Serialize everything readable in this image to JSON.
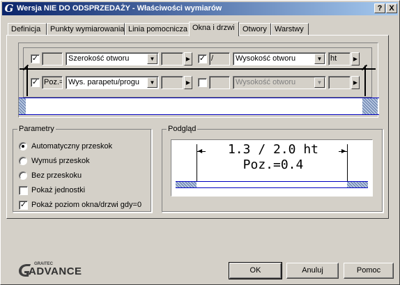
{
  "titlebar": {
    "app_icon": "G",
    "title": "Wersja NIE DO ODSPRZEDAŻY - Właściwości wymiarów",
    "help_button": "?",
    "close_button": "X"
  },
  "tabs": [
    {
      "label": "Definicja",
      "active": false
    },
    {
      "label": "Punkty wymiarowania",
      "active": false
    },
    {
      "label": "Linia pomocnicza",
      "active": false
    },
    {
      "label": "Okna i drzwi",
      "active": true
    },
    {
      "label": "Otwory",
      "active": false
    },
    {
      "label": "Warstwy",
      "active": false
    }
  ],
  "dim_editor": {
    "row1": {
      "left_checked": true,
      "left_prefix": "",
      "left_combo": "Szerokość otworu",
      "left_suffix": "",
      "right_checked": true,
      "right_prefix": "/",
      "right_combo": "Wysokość otworu",
      "right_suffix": "ht",
      "arrow": "▶"
    },
    "row2": {
      "left_checked": true,
      "left_prefix": "Poz.=",
      "left_combo": "Wys. parapetu/progu",
      "left_suffix": "",
      "right_checked": false,
      "right_prefix": "",
      "right_combo": "Wysokość otworu",
      "right_suffix": "",
      "arrow": "▶"
    }
  },
  "parametry": {
    "label": "Parametry",
    "radio_auto": "Automatyczny przeskok",
    "radio_force": "Wymuś przeskok",
    "radio_none": "Bez przeskoku",
    "selected": "auto",
    "chk_units": "Pokaż jednostki",
    "chk_units_checked": false,
    "chk_level": "Pokaż poziom okna/drzwi gdy=0",
    "chk_level_checked": true
  },
  "podglad": {
    "label": "Podgląd",
    "line1": "1.3 / 2.0 ht",
    "line2": "Poz.=0.4"
  },
  "buttons": {
    "ok": "OK",
    "cancel": "Anuluj",
    "help": "Pomoc"
  },
  "logo": {
    "brand_small": "GRAITEC",
    "brand": "ADVANCE"
  },
  "colors": {
    "title_start": "#0a246a",
    "title_end": "#a6caf0",
    "wall_line": "#0000c0"
  }
}
